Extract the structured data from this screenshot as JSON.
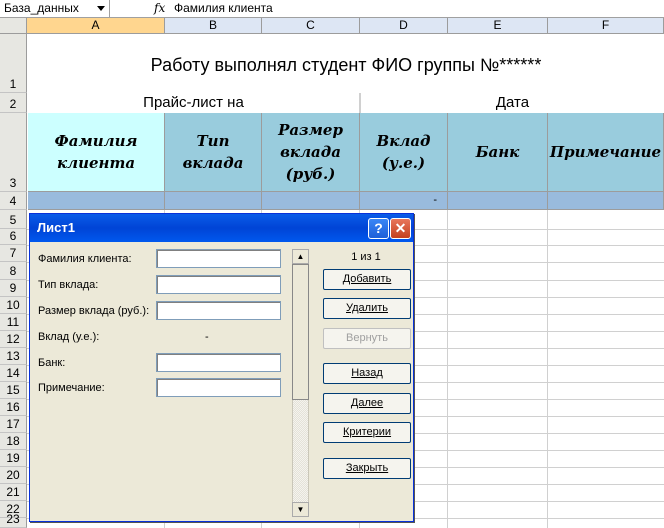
{
  "formula_bar": {
    "name_box": "База_данных",
    "fx_symbol": "fx",
    "value": "Фамилия клиента"
  },
  "columns": [
    "A",
    "B",
    "C",
    "D",
    "E",
    "F"
  ],
  "rows": [
    "1",
    "2",
    "3",
    "4",
    "5",
    "6",
    "7",
    "8",
    "9",
    "10",
    "11",
    "12",
    "13",
    "14",
    "15",
    "16",
    "17",
    "18",
    "19",
    "20",
    "21",
    "22",
    "23"
  ],
  "sheet": {
    "title": "Работу выполнял студент ФИО группы №******",
    "price_list": "Прайс-лист на",
    "date": "Дата",
    "headers": [
      "Фамилия клиента",
      "Тип вклада",
      "Размер вклада (руб.)",
      "Вклад (у.е.)",
      "Банк",
      "Примечание"
    ],
    "row4_d": "-"
  },
  "dialog": {
    "title": "Лист1",
    "help_symbol": "?",
    "close_symbol": "✕",
    "fields": [
      {
        "label": "Фамилия клиента:",
        "value": ""
      },
      {
        "label": "Тип вклада:",
        "value": ""
      },
      {
        "label": "Размер вклада (руб.):",
        "value": ""
      },
      {
        "label": "Вклад (у.е.):",
        "value": "-"
      },
      {
        "label": "Банк:",
        "value": ""
      },
      {
        "label": "Примечание:",
        "value": ""
      }
    ],
    "record_counter": "1 из 1",
    "buttons": {
      "add": "Добавить",
      "delete": "Удалить",
      "restore": "Вернуть",
      "back": "Назад",
      "next": "Далее",
      "criteria": "Критерии",
      "close": "Закрыть"
    }
  },
  "colors": {
    "header_first": "#ccffff",
    "header_other": "#99ccdd",
    "row4": "#99bbdd",
    "title_bar": "#0a5ce8"
  }
}
